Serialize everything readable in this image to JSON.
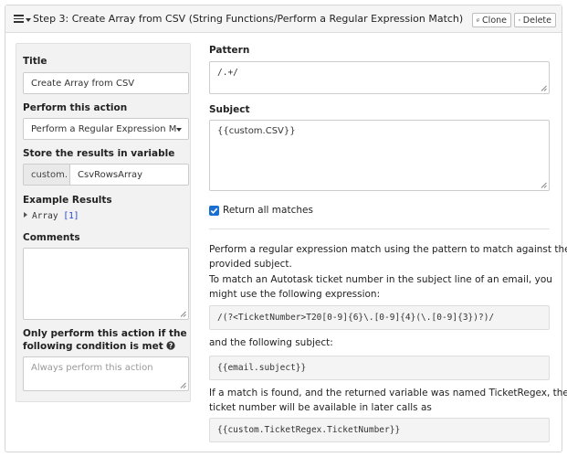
{
  "header": {
    "title": "Step 3: Create Array from CSV (String Functions/Perform a Regular Expression Match)",
    "clone_label": "Clone",
    "delete_label": "Delete"
  },
  "left": {
    "title_label": "Title",
    "title_value": "Create Array from CSV",
    "action_label": "Perform this action",
    "action_value": "Perform a Regular Expression M",
    "store_label": "Store the results in variable",
    "store_prefix": "custom.",
    "store_value": "CsvRowsArray",
    "example_label": "Example Results",
    "example_type": "Array",
    "example_count": "[1]",
    "comments_label": "Comments",
    "comments_value": "",
    "condition_label_line1": "Only perform this action if the",
    "condition_label_line2": "following condition is met",
    "condition_placeholder": "Always perform this action"
  },
  "right": {
    "pattern_label": "Pattern",
    "pattern_value": "/.+/",
    "subject_label": "Subject",
    "subject_value": "{{custom.CSV}}",
    "return_all_label": "Return all matches",
    "return_all_checked": true,
    "desc1_line1": "Perform a regular expression match using the pattern to match against the",
    "desc1_line2": "provided subject.",
    "desc2_line1": "To match an Autotask ticket number in the subject line of an email, you",
    "desc2_line2": "might use the following expression:",
    "code1": "/(?<TicketNumber>T20[0-9]{6}\\.[0-9]{4}(\\.[0-9]{3})?)/",
    "desc3": "and the following subject:",
    "code2": "{{email.subject}}",
    "desc4_line1": "If a match is found, and the returned variable was named TicketRegex, the",
    "desc4_line2": "ticket number will be available in later calls as",
    "code3": "{{custom.TicketRegex.TicketNumber}}"
  },
  "colors": {
    "accent": "#1a6fd1",
    "header_bg": "#f5f5f5",
    "left_panel_bg": "#f2f2f2",
    "code_bg": "#f4f4f4"
  }
}
